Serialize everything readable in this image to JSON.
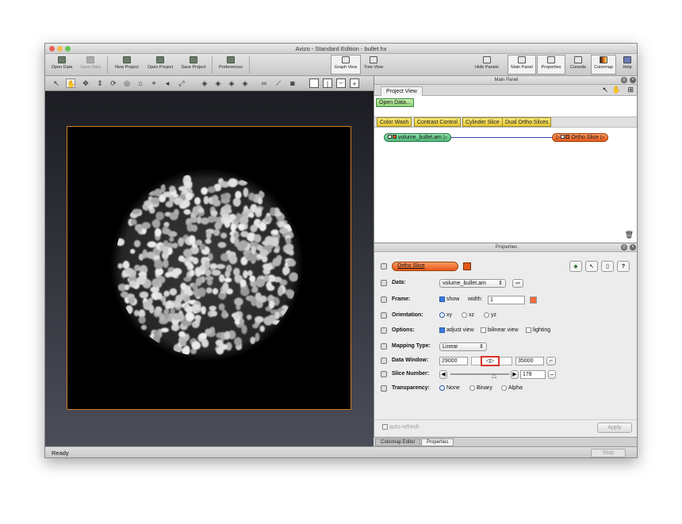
{
  "window": {
    "title": "Avizo - Standard Edition - bullet.hx"
  },
  "toolbar": {
    "left": [
      {
        "label": "Open Data",
        "icon": "folder-open-icon",
        "enabled": true
      },
      {
        "label": "Save Data",
        "icon": "save-icon",
        "enabled": false
      },
      {
        "label": "New Project",
        "icon": "new-project-icon",
        "enabled": true
      },
      {
        "label": "Open Project",
        "icon": "open-project-icon",
        "enabled": true
      },
      {
        "label": "Save Project",
        "icon": "save-project-icon",
        "enabled": true
      },
      {
        "label": "Preferences",
        "icon": "preferences-icon",
        "enabled": true
      }
    ],
    "views": [
      {
        "label": "Graph View",
        "active": true
      },
      {
        "label": "Tree View",
        "active": false
      }
    ],
    "right": [
      {
        "label": "Hide Panels",
        "active": false
      },
      {
        "label": "Main Panel",
        "active": true
      },
      {
        "label": "Properties",
        "active": true
      },
      {
        "label": "Console",
        "active": false
      },
      {
        "label": "Colormap",
        "active": true
      },
      {
        "label": "Help",
        "active": false
      }
    ]
  },
  "main_panel": {
    "title": "Main Panel",
    "tab": "Project View",
    "open_data_label": "Open Data...",
    "quick_modules": [
      "Color Wash",
      "Contrast Control",
      "Cylinder Slice",
      "Dual Ortho Slices"
    ],
    "nodes": {
      "data": "volume_bullet.am",
      "module": "Ortho Slice"
    }
  },
  "properties": {
    "title": "Properties",
    "module_name": "Ortho Slice",
    "data": {
      "label": "Data:",
      "value": "volume_bullet.am"
    },
    "frame": {
      "label": "Frame:",
      "show_label": "show",
      "show_checked": true,
      "width_label": "width:",
      "width": "1"
    },
    "orientation": {
      "label": "Orientation:",
      "options": [
        "xy",
        "xz",
        "yz"
      ],
      "selected": "xy"
    },
    "options": {
      "label": "Options:",
      "items": [
        {
          "label": "adjust view",
          "checked": true
        },
        {
          "label": "bilinear view",
          "checked": false
        },
        {
          "label": "lighting",
          "checked": false
        }
      ]
    },
    "mapping_type": {
      "label": "Mapping Type:",
      "value": "Linear"
    },
    "data_window": {
      "label": "Data Window:",
      "min": "29000",
      "max": "35000"
    },
    "slice_number": {
      "label": "Slice Number:",
      "value": "178"
    },
    "transparency": {
      "label": "Transparency:",
      "options": [
        "None",
        "Binary",
        "Alpha"
      ],
      "selected": "None"
    },
    "auto_refresh": "auto-refresh",
    "apply": "Apply"
  },
  "bottom_tabs": [
    "Colormap Editor",
    "Properties"
  ],
  "status": {
    "text": "Ready",
    "stop": "Stop"
  },
  "colors": {
    "accent": "#3b7bdc",
    "node_data": "#6ccb8e",
    "node_module": "#f07a3a",
    "canvas_border": "#d07a2a"
  }
}
